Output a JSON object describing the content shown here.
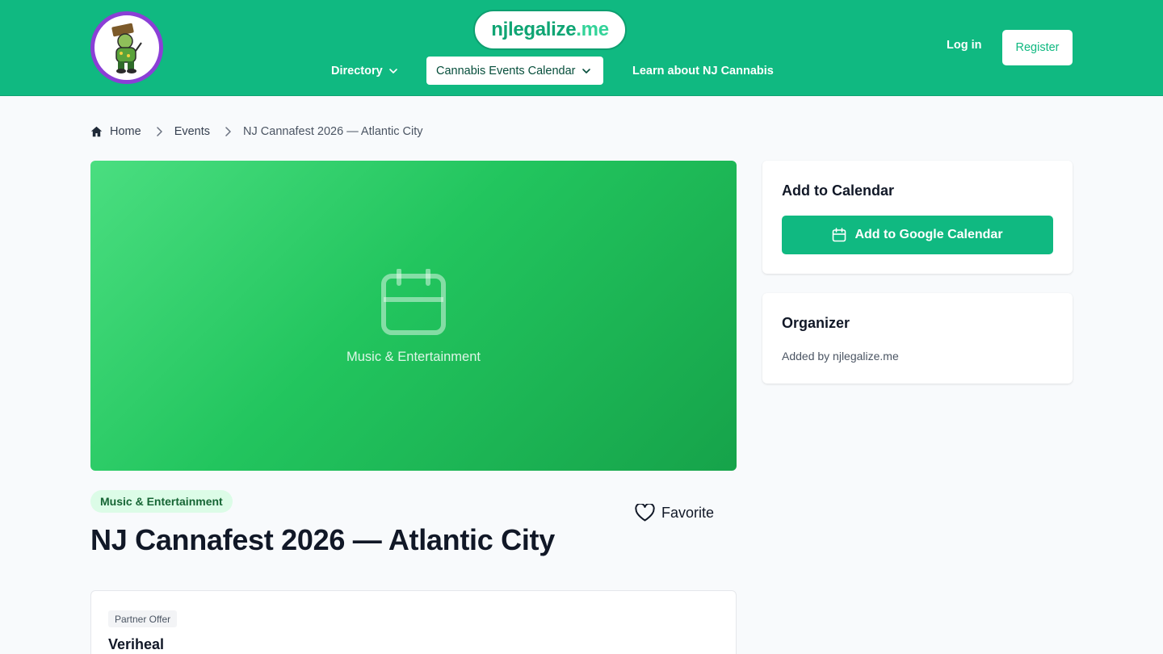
{
  "header": {
    "brand_part1": "njlegalize",
    "brand_part2": ".me",
    "nav": [
      {
        "label": "Directory",
        "has_dropdown": true
      },
      {
        "label": "Cannabis Events Calendar",
        "has_dropdown": true,
        "active": true
      },
      {
        "label": "Learn about NJ Cannabis",
        "has_dropdown": false
      }
    ],
    "login_label": "Log in",
    "register_label": "Register"
  },
  "breadcrumb": {
    "home": "Home",
    "events": "Events",
    "current": "NJ Cannafest 2026 — Atlantic City"
  },
  "event": {
    "hero_category": "Music & Entertainment",
    "tag": "Music & Entertainment",
    "favorite_label": "Favorite",
    "title": "NJ Cannafest 2026 — Atlantic City"
  },
  "partner": {
    "badge": "Partner Offer",
    "name": "Veriheal"
  },
  "sidebar": {
    "calendar_title": "Add to Calendar",
    "google_calendar_label": "Add to Google Calendar",
    "organizer_title": "Organizer",
    "organizer_text": "Added by njlegalize.me"
  },
  "colors": {
    "brand_green": "#10b981",
    "logo_ring": "#8b3fd6",
    "tag_bg": "#dcfce7",
    "tag_text": "#166534"
  },
  "icons": [
    "home-icon",
    "chevron-right-icon",
    "chevron-down-icon",
    "calendar-icon",
    "heart-icon"
  ]
}
